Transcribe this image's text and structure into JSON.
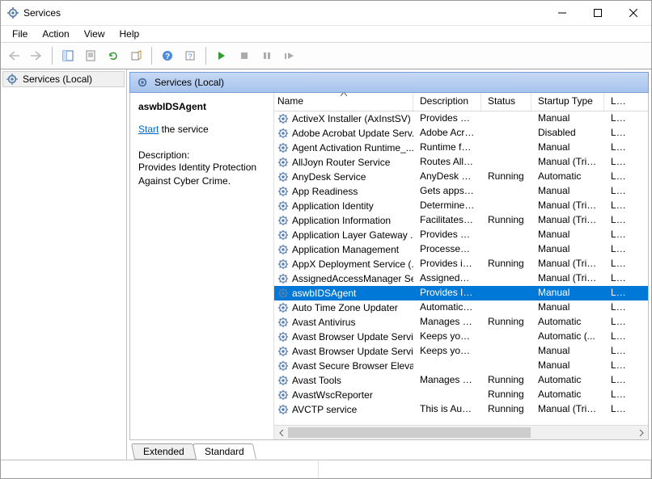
{
  "window": {
    "title": "Services"
  },
  "menu": {
    "file": "File",
    "action": "Action",
    "view": "View",
    "help": "Help"
  },
  "nav": {
    "root": "Services (Local)"
  },
  "pane": {
    "header": "Services (Local)"
  },
  "detail": {
    "name": "aswbIDSAgent",
    "start_link": "Start",
    "start_suffix": " the service",
    "desc_label": "Description:",
    "desc": "Provides Identity Protection Against Cyber Crime."
  },
  "columns": {
    "name": "Name",
    "desc": "Description",
    "status": "Status",
    "startup": "Startup Type",
    "logon": "Log On As"
  },
  "tabs": {
    "extended": "Extended",
    "standard": "Standard"
  },
  "services": [
    {
      "name": "ActiveX Installer (AxInstSV)",
      "desc": "Provides Us...",
      "status": "",
      "startup": "Manual",
      "logon": "Loca"
    },
    {
      "name": "Adobe Acrobat Update Serv...",
      "desc": "Adobe Acro...",
      "status": "",
      "startup": "Disabled",
      "logon": "Loca"
    },
    {
      "name": "Agent Activation Runtime_...",
      "desc": "Runtime for...",
      "status": "",
      "startup": "Manual",
      "logon": "Loca"
    },
    {
      "name": "AllJoyn Router Service",
      "desc": "Routes AllJo...",
      "status": "",
      "startup": "Manual (Trig...",
      "logon": "Loca"
    },
    {
      "name": "AnyDesk Service",
      "desc": "AnyDesk su...",
      "status": "Running",
      "startup": "Automatic",
      "logon": "Loca"
    },
    {
      "name": "App Readiness",
      "desc": "Gets apps re...",
      "status": "",
      "startup": "Manual",
      "logon": "Loca"
    },
    {
      "name": "Application Identity",
      "desc": "Determines ...",
      "status": "",
      "startup": "Manual (Trig...",
      "logon": "Loca"
    },
    {
      "name": "Application Information",
      "desc": "Facilitates t...",
      "status": "Running",
      "startup": "Manual (Trig...",
      "logon": "Loca"
    },
    {
      "name": "Application Layer Gateway ...",
      "desc": "Provides su...",
      "status": "",
      "startup": "Manual",
      "logon": "Loca"
    },
    {
      "name": "Application Management",
      "desc": "Processes in...",
      "status": "",
      "startup": "Manual",
      "logon": "Loca"
    },
    {
      "name": "AppX Deployment Service (...",
      "desc": "Provides inf...",
      "status": "Running",
      "startup": "Manual (Trig...",
      "logon": "Loca"
    },
    {
      "name": "AssignedAccessManager Se...",
      "desc": "AssignedAc...",
      "status": "",
      "startup": "Manual (Trig...",
      "logon": "Loca"
    },
    {
      "name": "aswbIDSAgent",
      "desc": "Provides Ide...",
      "status": "",
      "startup": "Manual",
      "logon": "Loca",
      "selected": true
    },
    {
      "name": "Auto Time Zone Updater",
      "desc": "Automatica...",
      "status": "",
      "startup": "Manual",
      "logon": "Loca"
    },
    {
      "name": "Avast Antivirus",
      "desc": "Manages an...",
      "status": "Running",
      "startup": "Automatic",
      "logon": "Loca"
    },
    {
      "name": "Avast Browser Update Servi...",
      "desc": "Keeps your ...",
      "status": "",
      "startup": "Automatic (...",
      "logon": "Loca"
    },
    {
      "name": "Avast Browser Update Servi...",
      "desc": "Keeps your ...",
      "status": "",
      "startup": "Manual",
      "logon": "Loca"
    },
    {
      "name": "Avast Secure Browser Elevat...",
      "desc": "",
      "status": "",
      "startup": "Manual",
      "logon": "Loca"
    },
    {
      "name": "Avast Tools",
      "desc": "Manages an...",
      "status": "Running",
      "startup": "Automatic",
      "logon": "Loca"
    },
    {
      "name": "AvastWscReporter",
      "desc": "",
      "status": "Running",
      "startup": "Automatic",
      "logon": "Loca"
    },
    {
      "name": "AVCTP service",
      "desc": "This is Audi...",
      "status": "Running",
      "startup": "Manual (Trig...",
      "logon": "Loca"
    }
  ],
  "selected_index": 12
}
